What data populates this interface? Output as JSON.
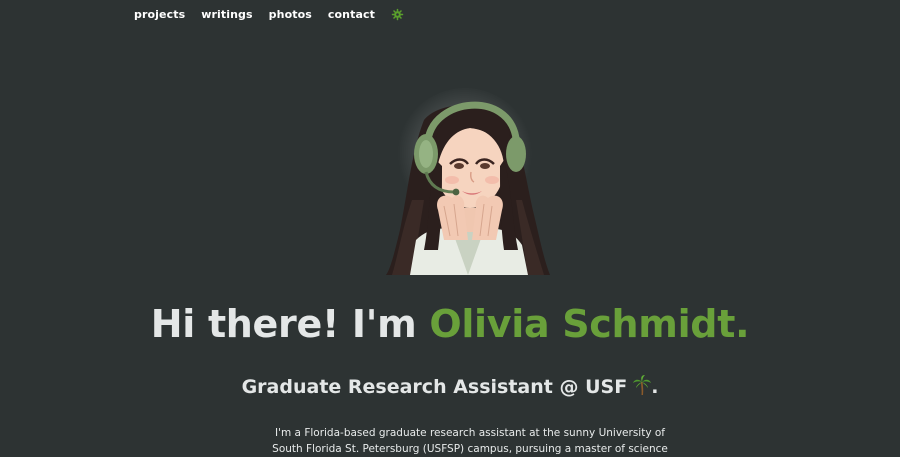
{
  "nav": {
    "items": [
      {
        "label": "projects"
      },
      {
        "label": "writings"
      },
      {
        "label": "photos"
      },
      {
        "label": "contact"
      }
    ],
    "theme_icon": "gear-icon"
  },
  "hero": {
    "avatar_icon": "avatar-illustration",
    "greeting": "Hi there! I'm ",
    "name": "Olivia Schmidt.",
    "subtitle": "Graduate Research Assistant @ USF",
    "subtitle_suffix": ".",
    "subtitle_icon": "palm-tree-icon",
    "bio": "I'm a Florida-based graduate research assistant at the sunny University of South Florida St. Petersburg (USFSP) campus, pursuing a master of science"
  },
  "colors": {
    "background": "#2d3333",
    "accent": "#69a03a",
    "text": "#e4e7e7"
  }
}
